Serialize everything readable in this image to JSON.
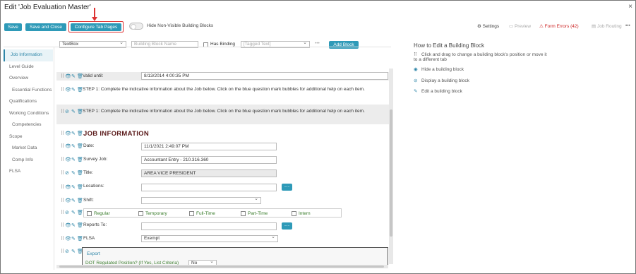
{
  "window": {
    "title": "Edit 'Job Evaluation Master'",
    "close": "×"
  },
  "toolbar": {
    "save": "Save",
    "save_close": "Save and Close",
    "configure": "Configure Tab Pages",
    "hide_nonvisible": "Hide Non-Visible Building Blocks",
    "settings": "Settings",
    "preview": "Preview",
    "form_errors": "Form Errors (42)",
    "job_routing": "Job Routing",
    "more": "•••"
  },
  "builder": {
    "type_select": "TextBox",
    "block_name_placeholder": "Building Block Name",
    "has_binding": "Has Binding",
    "tagged_text_placeholder": "[Tagged Text]",
    "ellipsis": "•••",
    "add_block": "Add Block"
  },
  "sidebar": {
    "items": [
      {
        "label": "Job Information",
        "active": true
      },
      {
        "label": "Level Guide"
      },
      {
        "label": "Overview"
      },
      {
        "label": "Essential Functions",
        "sub": true
      },
      {
        "label": "Qualifications"
      },
      {
        "label": "Working Conditions"
      },
      {
        "label": "Competencies",
        "sub": true
      },
      {
        "label": "Scope"
      },
      {
        "label": "Market Data",
        "sub": true
      },
      {
        "label": "Comp Info",
        "sub": true
      },
      {
        "label": "FLSA"
      }
    ]
  },
  "form": {
    "valid_until_label": "Valid until:",
    "valid_until_value": "8/13/2014 4:00:35 PM",
    "step1_a": "STEP 1:  Complete the indicative information about the Job below.  Click on the blue question mark bubbles for additional help on each item.",
    "step1_b": "STEP 1:  Complete the indicative information about the Job below.  Click on the blue question mark bubbles for additional help on each item.",
    "section_heading": "JOB INFORMATION",
    "date_label": "Date:",
    "date_value": "11/1/2021 2:49:07 PM",
    "survey_label": "Survey Job:",
    "survey_value": "Accountant Entry - 210.316.360",
    "title_label": "Title:",
    "title_value": "AREA VICE PRESIDENT",
    "locations_label": "Locations:",
    "locations_value": "",
    "shift_label": "Shift:",
    "shift_value": "",
    "employment_options": [
      "Regular",
      "Temporary",
      "Full-Time",
      "Part-Time",
      "Intern"
    ],
    "reports_label": "Reports To:",
    "reports_value": "",
    "flsa_label": "FLSA",
    "flsa_value": "Exempt",
    "export_label": "Export",
    "dot_label": "DOT Regulated Position? (If Yes, List Criteria)",
    "dot_value": "No"
  },
  "help": {
    "title": "How to Edit a Building Block",
    "drag": "Click and drag to change a building block's position or move it to a different tab",
    "hide": "Hide a building block",
    "display": "Display a building block",
    "edit": "Edit a building block"
  },
  "colors": {
    "accent": "#2e9ab8",
    "highlight": "#dd3333",
    "heading": "#5a1a1a",
    "option_text": "#3a7d2c"
  }
}
